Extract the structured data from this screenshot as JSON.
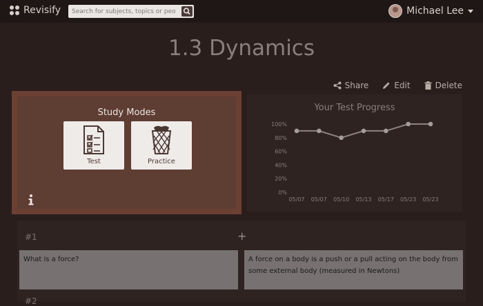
{
  "app": {
    "name": "Revisify"
  },
  "search": {
    "placeholder": "Search for subjects, topics or people"
  },
  "user": {
    "name": "Michael Lee"
  },
  "page": {
    "title": "1.3 Dynamics"
  },
  "actions": {
    "share": "Share",
    "edit": "Edit",
    "delete": "Delete"
  },
  "study_modes": {
    "title": "Study Modes",
    "test_label": "Test",
    "practice_label": "Practice"
  },
  "progress": {
    "title": "Your Test Progress"
  },
  "chart_data": {
    "type": "line",
    "title": "Your Test Progress",
    "categories": [
      "05/07",
      "05/07",
      "05/10",
      "05/13",
      "05/17",
      "05/23",
      "05/23"
    ],
    "series": [
      {
        "values": [
          90,
          90,
          80,
          90,
          90,
          100,
          100
        ]
      }
    ],
    "ylim": [
      0,
      100
    ],
    "yticks": [
      "0%",
      "20%",
      "40%",
      "60%",
      "80%",
      "100%"
    ],
    "grid": false,
    "colors": {
      "line": "#8c8480",
      "point": "#a59d99",
      "tick": "#8a7f7a"
    }
  },
  "cards": [
    {
      "number": "#1",
      "question": "What is a force?",
      "answer": "A force on a body is a push or a pull acting on the body from some external body (measured in Newtons)"
    }
  ],
  "next_card_number": "#2",
  "icons": {
    "logo": "grid-dots-icon",
    "search": "search-icon",
    "caret": "chevron-down-icon",
    "share": "share-icon",
    "edit": "pencil-icon",
    "delete": "trash-icon",
    "test": "test-sheet-icon",
    "practice": "practice-basket-icon",
    "info": "info-icon",
    "add": "plus-icon"
  },
  "colors": {
    "background": "#2a1e1c",
    "accent": "#6b4033",
    "card_box": "#777171"
  }
}
